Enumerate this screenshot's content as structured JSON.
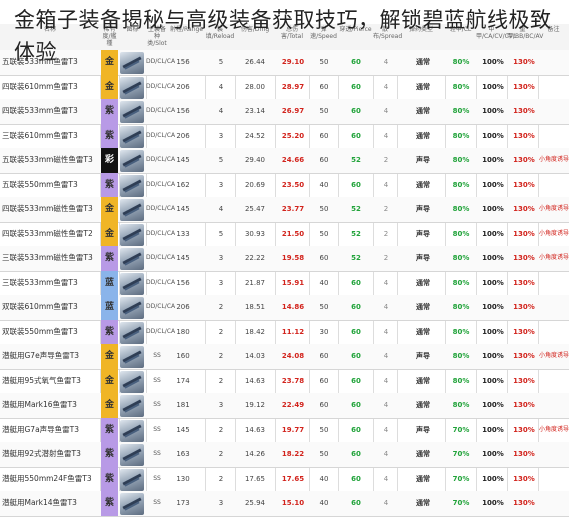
{
  "article_title": "金箱子装备揭秘与高级装备获取技巧，解锁碧蓝航线极致体验",
  "header": {
    "cols": [
      "名称",
      "稀有度/艦種",
      "图标",
      "主装备种类/Slot",
      "射程/Range",
      "装填/Reload",
      "伤害/Dmg",
      "总伤害/Total",
      "弹速/Speed",
      "穿透/Pierce",
      "散布/Spread",
      "弹药类型",
      "轻甲/CL",
      "中甲/CA/CV/CVL",
      "重甲/BB/BC/AV",
      "备注"
    ]
  },
  "colors": {
    "gold": "#f0b526",
    "purple": "#b89ae6",
    "blue": "#8ab4ea",
    "rainbow": "#111111",
    "red": "#d2231c",
    "green": "#21a33a"
  },
  "rows": [
    {
      "name": "五联装533mm鱼雷T3",
      "tier": "金",
      "tier_class": "tier-gold",
      "slot": "DD/CL/CA",
      "v1": "156",
      "v2": "5",
      "v3": "26.44",
      "red": "29.10",
      "v4": "50",
      "green": "60",
      "dash": "4",
      "type": "通常",
      "p1": "80%",
      "p2": "100%",
      "p3": "130%",
      "note": ""
    },
    {
      "name": "四联装610mm鱼雷T3",
      "tier": "金",
      "tier_class": "tier-gold",
      "slot": "DD/CL/CA",
      "v1": "206",
      "v2": "4",
      "v3": "28.00",
      "red": "28.97",
      "v4": "60",
      "green": "60",
      "dash": "4",
      "type": "通常",
      "p1": "80%",
      "p2": "100%",
      "p3": "130%",
      "note": ""
    },
    {
      "name": "四联装533mm鱼雷T3",
      "tier": "紫",
      "tier_class": "tier-purple",
      "slot": "DD/CL/CA",
      "v1": "156",
      "v2": "4",
      "v3": "23.14",
      "red": "26.97",
      "v4": "50",
      "green": "60",
      "dash": "4",
      "type": "通常",
      "p1": "80%",
      "p2": "100%",
      "p3": "130%",
      "note": ""
    },
    {
      "name": "三联装610mm鱼雷T3",
      "tier": "紫",
      "tier_class": "tier-purple",
      "slot": "DD/CL/CA",
      "v1": "206",
      "v2": "3",
      "v3": "24.52",
      "red": "25.20",
      "v4": "60",
      "green": "60",
      "dash": "4",
      "type": "通常",
      "p1": "80%",
      "p2": "100%",
      "p3": "130%",
      "note": ""
    },
    {
      "name": "五联装533mm磁性鱼雷T3",
      "tier": "彩",
      "tier_class": "tier-rainbow",
      "slot": "DD/CL/CA",
      "v1": "145",
      "v2": "5",
      "v3": "29.40",
      "red": "24.66",
      "v4": "60",
      "green": "52",
      "dash": "2",
      "type": "声导",
      "p1": "80%",
      "p2": "100%",
      "p3": "130%",
      "note": "小角度诱导"
    },
    {
      "name": "五联装550mm鱼雷T3",
      "tier": "紫",
      "tier_class": "tier-purple",
      "slot": "DD/CL/CA",
      "v1": "162",
      "v2": "3",
      "v3": "20.69",
      "red": "23.50",
      "v4": "40",
      "green": "60",
      "dash": "4",
      "type": "通常",
      "p1": "80%",
      "p2": "100%",
      "p3": "130%",
      "note": ""
    },
    {
      "name": "四联装533mm磁性鱼雷T3",
      "tier": "金",
      "tier_class": "tier-gold",
      "slot": "DD/CL/CA",
      "v1": "145",
      "v2": "4",
      "v3": "25.47",
      "red": "23.77",
      "v4": "50",
      "green": "52",
      "dash": "2",
      "type": "声导",
      "p1": "80%",
      "p2": "100%",
      "p3": "130%",
      "note": "小角度诱导"
    },
    {
      "name": "四联装533mm磁性鱼雷T2",
      "tier": "金",
      "tier_class": "tier-gold",
      "slot": "DD/CL/CA",
      "v1": "133",
      "v2": "5",
      "v3": "30.93",
      "red": "21.50",
      "v4": "50",
      "green": "52",
      "dash": "2",
      "type": "声导",
      "p1": "80%",
      "p2": "100%",
      "p3": "130%",
      "note": "小角度诱导"
    },
    {
      "name": "三联装533mm磁性鱼雷T3",
      "tier": "紫",
      "tier_class": "tier-purple",
      "slot": "DD/CL/CA",
      "v1": "145",
      "v2": "3",
      "v3": "22.22",
      "red": "19.58",
      "v4": "60",
      "green": "52",
      "dash": "2",
      "type": "声导",
      "p1": "80%",
      "p2": "100%",
      "p3": "130%",
      "note": "小角度诱导"
    },
    {
      "name": "三联装533mm鱼雷T3",
      "tier": "蓝",
      "tier_class": "tier-blue",
      "slot": "DD/CL/CA",
      "v1": "156",
      "v2": "3",
      "v3": "21.87",
      "red": "15.91",
      "v4": "40",
      "green": "60",
      "dash": "4",
      "type": "通常",
      "p1": "80%",
      "p2": "100%",
      "p3": "130%",
      "note": ""
    },
    {
      "name": "双联装610mm鱼雷T3",
      "tier": "蓝",
      "tier_class": "tier-blue",
      "slot": "DD/CL/CA",
      "v1": "206",
      "v2": "2",
      "v3": "18.51",
      "red": "14.86",
      "v4": "50",
      "green": "60",
      "dash": "4",
      "type": "通常",
      "p1": "80%",
      "p2": "100%",
      "p3": "130%",
      "note": ""
    },
    {
      "name": "双联装550mm鱼雷T3",
      "tier": "紫",
      "tier_class": "tier-purple",
      "slot": "DD/CL/CA",
      "v1": "180",
      "v2": "2",
      "v3": "18.42",
      "red": "11.12",
      "v4": "30",
      "green": "60",
      "dash": "4",
      "type": "通常",
      "p1": "80%",
      "p2": "100%",
      "p3": "130%",
      "note": ""
    },
    {
      "name": "潜艇用G7e声导鱼雷T3",
      "tier": "金",
      "tier_class": "tier-gold",
      "slot": "SS",
      "v1": "160",
      "v2": "2",
      "v3": "14.03",
      "red": "24.08",
      "v4": "60",
      "green": "60",
      "dash": "4",
      "type": "声导",
      "p1": "80%",
      "p2": "100%",
      "p3": "130%",
      "note": "小角度诱导"
    },
    {
      "name": "潜艇用95式氧气鱼雷T3",
      "tier": "金",
      "tier_class": "tier-gold",
      "slot": "SS",
      "v1": "174",
      "v2": "2",
      "v3": "14.63",
      "red": "23.78",
      "v4": "60",
      "green": "60",
      "dash": "4",
      "type": "通常",
      "p1": "80%",
      "p2": "100%",
      "p3": "130%",
      "note": ""
    },
    {
      "name": "潜艇用Mark16鱼雷T3",
      "tier": "金",
      "tier_class": "tier-gold",
      "slot": "SS",
      "v1": "181",
      "v2": "3",
      "v3": "19.12",
      "red": "22.49",
      "v4": "60",
      "green": "60",
      "dash": "4",
      "type": "通常",
      "p1": "80%",
      "p2": "100%",
      "p3": "130%",
      "note": ""
    },
    {
      "name": "潜艇用G7a声导鱼雷T3",
      "tier": "紫",
      "tier_class": "tier-purple",
      "slot": "SS",
      "v1": "145",
      "v2": "2",
      "v3": "14.63",
      "red": "19.77",
      "v4": "50",
      "green": "60",
      "dash": "4",
      "type": "声导",
      "p1": "70%",
      "p2": "100%",
      "p3": "130%",
      "note": "小角度诱导"
    },
    {
      "name": "潜艇用92式潜射鱼雷T3",
      "tier": "紫",
      "tier_class": "tier-purple",
      "slot": "SS",
      "v1": "163",
      "v2": "2",
      "v3": "14.26",
      "red": "18.22",
      "v4": "50",
      "green": "60",
      "dash": "4",
      "type": "通常",
      "p1": "70%",
      "p2": "100%",
      "p3": "130%",
      "note": ""
    },
    {
      "name": "潜艇用550mm24F鱼雷T3",
      "tier": "紫",
      "tier_class": "tier-purple",
      "slot": "SS",
      "v1": "130",
      "v2": "2",
      "v3": "17.65",
      "red": "17.65",
      "v4": "40",
      "green": "60",
      "dash": "4",
      "type": "通常",
      "p1": "70%",
      "p2": "100%",
      "p3": "130%",
      "note": ""
    },
    {
      "name": "潜艇用Mark14鱼雷T3",
      "tier": "紫",
      "tier_class": "tier-purple",
      "slot": "SS",
      "v1": "173",
      "v2": "3",
      "v3": "25.94",
      "red": "15.10",
      "v4": "40",
      "green": "60",
      "dash": "4",
      "type": "通常",
      "p1": "70%",
      "p2": "100%",
      "p3": "130%",
      "note": ""
    }
  ]
}
